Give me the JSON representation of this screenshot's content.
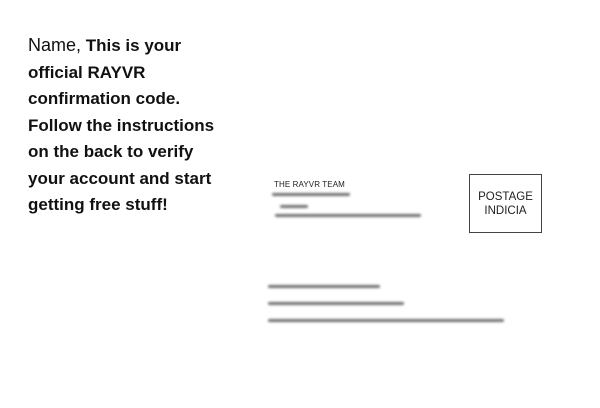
{
  "message": {
    "name": "Name,",
    "text": "This is your official RAYVR confirmation code. Follow the instructions on the back to verify your account and start getting free stuff!"
  },
  "return_address": {
    "title": "THE RAYVR TEAM"
  },
  "indicia": {
    "line1": "POSTAGE",
    "line2": "INDICIA"
  }
}
